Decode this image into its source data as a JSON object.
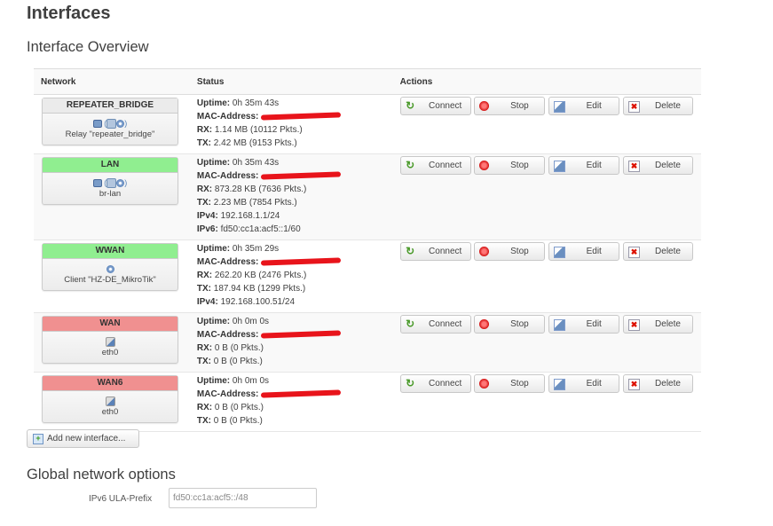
{
  "page_title": "Interfaces",
  "overview_title": "Interface Overview",
  "table": {
    "headers": {
      "network": "Network",
      "status": "Status",
      "actions": "Actions"
    },
    "status_labels": {
      "uptime": "Uptime:",
      "mac": "MAC-Address:",
      "rx": "RX:",
      "tx": "TX:",
      "ipv4": "IPv4:",
      "ipv6": "IPv6:"
    },
    "actions": {
      "connect": "Connect",
      "stop": "Stop",
      "edit": "Edit",
      "delete": "Delete"
    },
    "rows": [
      {
        "name": "REPEATER_BRIDGE",
        "header_color": "#ebebeb",
        "icons": [
          "bridge-icon",
          "switch-icon",
          "wifi-icon"
        ],
        "icon_text": "()",
        "device": "Relay \"repeater_bridge\"",
        "uptime": "0h 35m 43s",
        "rx": "1.14 MB (10112 Pkts.)",
        "tx": "2.42 MB (9153 Pkts.)"
      },
      {
        "name": "LAN",
        "header_color": "#90ee90",
        "icons": [
          "bridge-icon",
          "switch-icon",
          "wifi-icon"
        ],
        "device": "br-lan",
        "uptime": "0h 35m 43s",
        "rx": "873.28 KB (7636 Pkts.)",
        "tx": "2.23 MB (7854 Pkts.)",
        "ipv4": "192.168.1.1/24",
        "ipv6": "fd50:cc1a:acf5::1/60"
      },
      {
        "name": "WWAN",
        "header_color": "#90ee90",
        "icons": [
          "wifi-icon"
        ],
        "device": "Client \"HZ-DE_MikroTik\"",
        "uptime": "0h 35m 29s",
        "rx": "262.20 KB (2476 Pkts.)",
        "tx": "187.94 KB (1299 Pkts.)",
        "ipv4": "192.168.100.51/24"
      },
      {
        "name": "WAN",
        "header_color": "#f09090",
        "icons": [
          "ethernet-icon"
        ],
        "device": "eth0",
        "uptime": "0h 0m 0s",
        "rx": "0 B (0 Pkts.)",
        "tx": "0 B (0 Pkts.)"
      },
      {
        "name": "WAN6",
        "header_color": "#f09090",
        "icons": [
          "ethernet-icon"
        ],
        "device": "eth0",
        "uptime": "0h 0m 0s",
        "rx": "0 B (0 Pkts.)",
        "tx": "0 B (0 Pkts.)"
      }
    ]
  },
  "add_interface_label": "Add new interface...",
  "global_title": "Global network options",
  "ula_prefix": {
    "label": "IPv6 ULA-Prefix",
    "value": "fd50:cc1a:acf5::/48"
  }
}
